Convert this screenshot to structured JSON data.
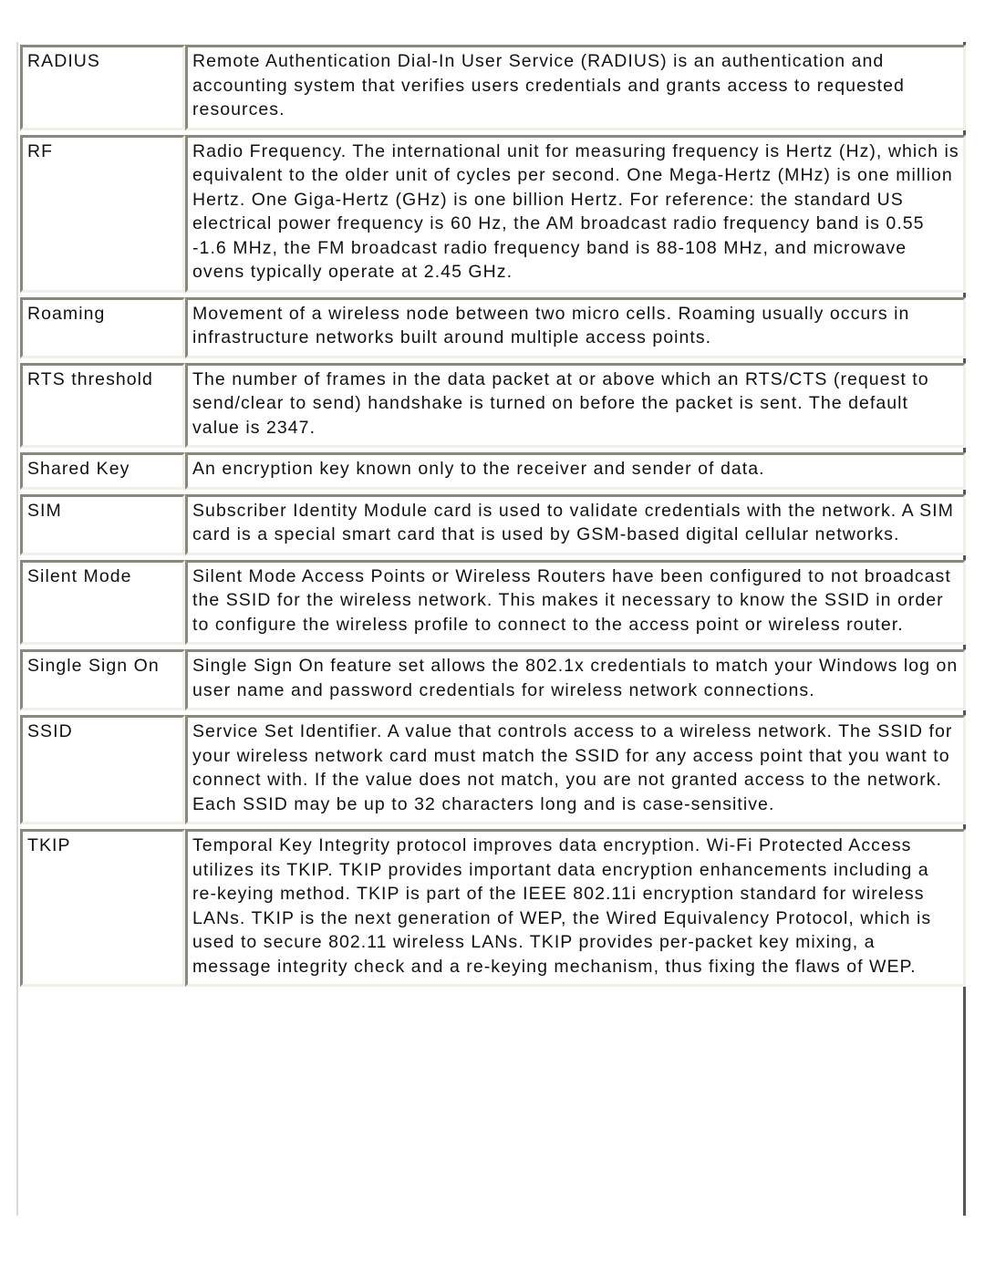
{
  "glossary": {
    "entries": [
      {
        "term": "RADIUS",
        "definition": "Remote Authentication Dial-In User Service (RADIUS) is an authentication and accounting system that verifies users credentials and grants access to requested resources."
      },
      {
        "term": "RF",
        "definition": "Radio Frequency. The international unit for measuring frequency is Hertz (Hz), which is equivalent to the older unit of cycles per second. One Mega-Hertz (MHz) is one million Hertz. One Giga-Hertz (GHz) is one billion Hertz. For reference: the standard US electrical power frequency is 60 Hz, the AM broadcast radio frequency band is 0.55 -1.6 MHz, the FM broadcast radio frequency band is 88-108 MHz, and microwave ovens typically operate at 2.45 GHz."
      },
      {
        "term": "Roaming",
        "definition": "Movement of a wireless node between two micro cells. Roaming usually occurs in infrastructure networks built around multiple access points."
      },
      {
        "term": "RTS threshold",
        "definition": "The number of frames in the data packet at or above which an RTS/CTS (request to send/clear to send) handshake is turned on before the packet is sent. The default value is 2347."
      },
      {
        "term": "Shared Key",
        "definition": "An encryption key known only to the receiver and sender of data."
      },
      {
        "term": "SIM",
        "definition": "Subscriber Identity Module card is used to validate credentials with the network. A SIM card is a special smart card that is used by GSM-based digital cellular networks."
      },
      {
        "term": "Silent Mode",
        "definition": "Silent Mode Access Points or Wireless Routers have been configured to not broadcast the SSID for the wireless network.  This makes it necessary to know the SSID in order to configure the wireless profile to connect to the access point or wireless router."
      },
      {
        "term": "Single Sign On",
        "definition": "Single Sign On feature set allows the 802.1x credentials to match your Windows log on user name and password credentials for wireless network connections."
      },
      {
        "term": "SSID",
        "definition": "Service Set Identifier. A value that controls access to a wireless network. The SSID for your wireless network card must match the SSID for any access point that you want to connect with. If the value does not match, you are not granted access to the network. Each SSID may be up to 32 characters long and is case-sensitive."
      },
      {
        "term": "TKIP",
        "definition": "Temporal Key Integrity protocol improves data encryption. Wi-Fi Protected Access utilizes its TKIP. TKIP provides important data encryption enhancements including a re-keying method. TKIP is part of the IEEE 802.11i encryption standard for wireless LANs. TKIP is the next generation of WEP, the Wired Equivalency Protocol, which is used to secure 802.11 wireless LANs. TKIP provides per-packet key mixing, a message integrity check and a re-keying mechanism, thus fixing the flaws of WEP."
      }
    ]
  }
}
